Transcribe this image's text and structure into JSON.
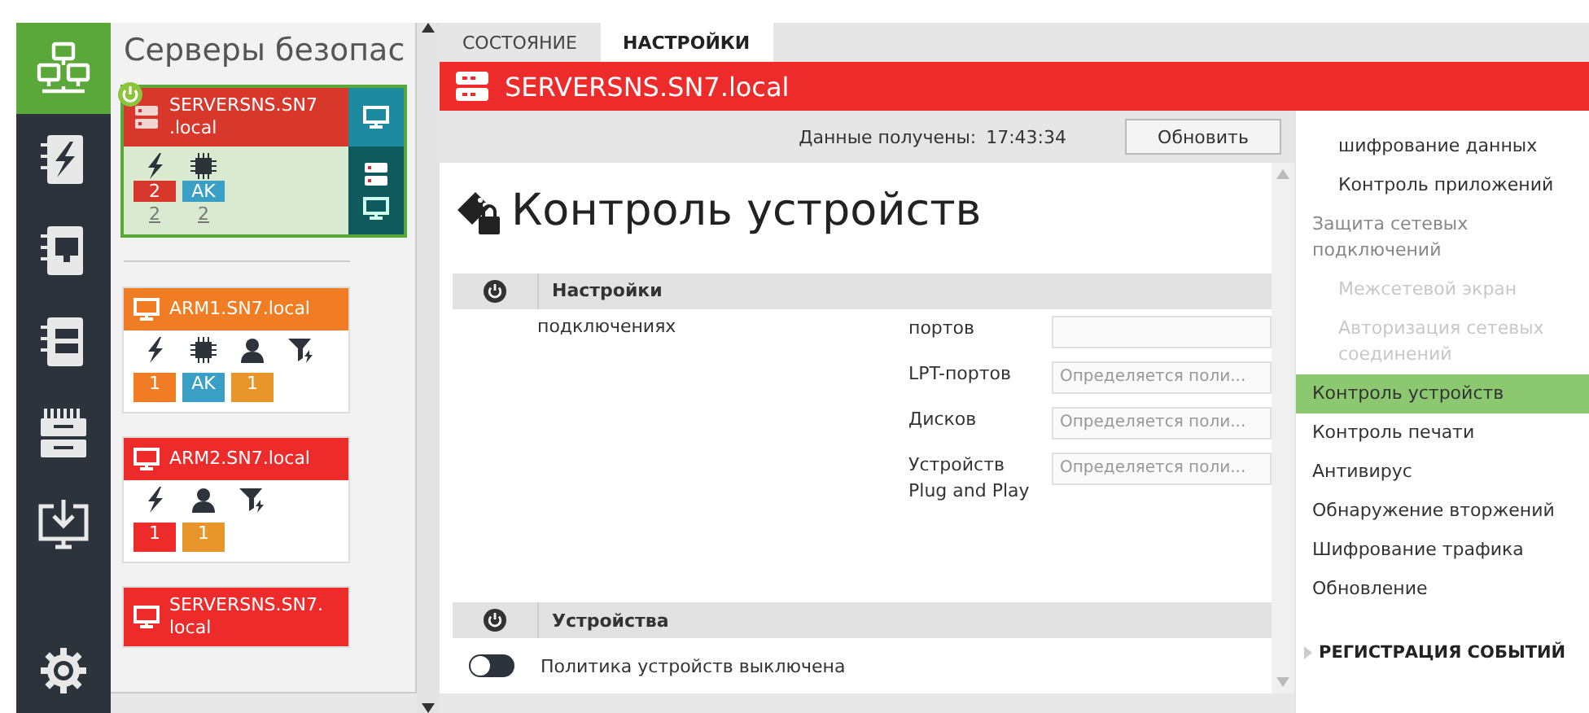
{
  "rail": [
    {
      "kind": "network",
      "selected": true
    },
    {
      "kind": "event-log",
      "selected": false
    },
    {
      "kind": "monitor-log",
      "selected": false
    },
    {
      "kind": "server-log",
      "selected": false
    },
    {
      "kind": "hardware",
      "selected": false
    },
    {
      "kind": "install",
      "selected": false
    },
    {
      "kind": "settings",
      "selected": false
    }
  ],
  "servers_panel": {
    "title": "Серверы безопас",
    "cards": [
      {
        "name_lines": [
          "SERVERSNS.SN7",
          ".local"
        ],
        "kind": "server",
        "color": "#d8372c",
        "selected": true,
        "power": true,
        "side_panel": true,
        "indicators": [
          {
            "kind": "events",
            "badge": "2",
            "color": "#d8372c",
            "count": "2"
          },
          {
            "kind": "hardware",
            "badge": "AK",
            "color": "#3a9fc4",
            "count": "2"
          }
        ]
      },
      {
        "name_lines": [
          "ARM1.SN7.local"
        ],
        "kind": "workstation",
        "color": "#f07d24",
        "selected": false,
        "power": false,
        "side_panel": false,
        "indicators": [
          {
            "kind": "events",
            "badge": "1",
            "color": "#f07d24"
          },
          {
            "kind": "hardware",
            "badge": "AK",
            "color": "#3a9fc4"
          },
          {
            "kind": "user",
            "badge": "1",
            "color": "#e8952a"
          },
          {
            "kind": "filter"
          }
        ]
      },
      {
        "name_lines": [
          "ARM2.SN7.local"
        ],
        "kind": "workstation",
        "color": "#ee2b2b",
        "selected": false,
        "power": false,
        "side_panel": false,
        "indicators": [
          {
            "kind": "events",
            "badge": "1",
            "color": "#ee2b2b"
          },
          {
            "kind": "user",
            "badge": "1",
            "color": "#e8952a"
          },
          {
            "kind": "filter"
          }
        ]
      },
      {
        "name_lines": [
          "SERVERSNS.SN7.",
          "local"
        ],
        "kind": "workstation",
        "color": "#ee2b2b",
        "selected": false,
        "power": false,
        "side_panel": false
      }
    ]
  },
  "tabs": [
    {
      "label": "СОСТОЯНИЕ",
      "selected": false
    },
    {
      "label": "НАСТРОЙКИ",
      "selected": true
    }
  ],
  "header": {
    "title": "SERVERSNS.SN7.local"
  },
  "info_bar": {
    "received_label": "Данные получены:",
    "time": "17:43:34",
    "refresh_button": "Обновить"
  },
  "page_title": "Контроль устройств",
  "settings_section": {
    "title": "Настройки",
    "left_text": "подключениях",
    "fields": [
      {
        "label": "портов"
      },
      {
        "label": "LPT-портов",
        "value": "Определяется поли..."
      },
      {
        "label": "Дисков",
        "value": "Определяется поли..."
      },
      {
        "label": "Устройств Plug and Play",
        "value": "Определяется поли..."
      }
    ]
  },
  "devices_section": {
    "title": "Устройства",
    "toggle": {
      "on": false,
      "label": "Политика устройств выключена"
    }
  },
  "nav": {
    "items": [
      {
        "label": "шифрование данных",
        "selected": false,
        "disabled": false,
        "indented": true
      },
      {
        "label": "Контроль приложений",
        "selected": false,
        "disabled": false,
        "indented": true
      },
      {
        "label": "Защита сетевых подключений",
        "selected": false,
        "disabled": false,
        "children": [
          {
            "label": "Межсетевой экран",
            "selected": false,
            "disabled": true
          },
          {
            "label": "Авторизация сетевых соединений",
            "selected": false,
            "disabled": true
          }
        ]
      },
      {
        "label": "Контроль устройств",
        "selected": true,
        "disabled": false
      },
      {
        "label": "Контроль печати",
        "selected": false,
        "disabled": false
      },
      {
        "label": "Антивирус",
        "selected": false,
        "disabled": false
      },
      {
        "label": "Обнаружение вторжений",
        "selected": false,
        "disabled": false
      },
      {
        "label": "Шифрование трафика",
        "selected": false,
        "disabled": false
      },
      {
        "label": "Обновление",
        "selected": false,
        "disabled": false
      }
    ],
    "section": {
      "label": "РЕГИСТРАЦИЯ СОБЫТИЙ",
      "expanded": false
    }
  }
}
